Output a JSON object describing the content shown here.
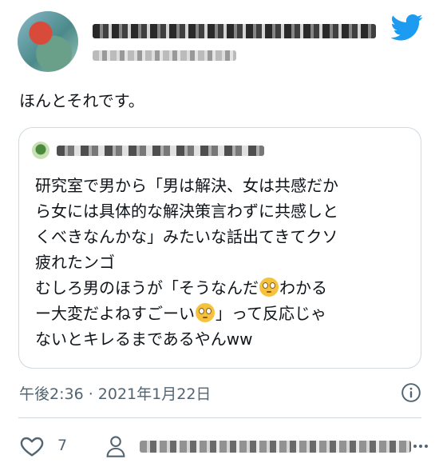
{
  "tweet": {
    "text": "ほんとそれです。",
    "timestamp": "午後2:36 · 2021年1月22日",
    "likes": "7"
  },
  "quote": {
    "lines": [
      {
        "text": "研究室で男から「男は解決、女は共感だか"
      },
      {
        "text": "ら女には具体的な解決策言わずに共感しと"
      },
      {
        "text": "くべきなんかな」みたいな話出てきてクソ"
      },
      {
        "text": "疲れたンゴ"
      },
      {
        "before": "むしろ男のほうが「そうなんだ",
        "after": "わかる"
      },
      {
        "before": "ー大変だよねすごーい",
        "after": "」って反応じゃ"
      },
      {
        "text": "ないとキレるまであるやんww"
      }
    ]
  },
  "icons": {
    "brand": "twitter-bird-icon",
    "info": "info-icon",
    "like": "heart-icon",
    "profile": "person-icon",
    "emoji": "face-with-rolling-eyes-emoji"
  },
  "colors": {
    "brand": "#1d9bf0",
    "secondary_text": "#536471",
    "border": "#cfd9de"
  }
}
